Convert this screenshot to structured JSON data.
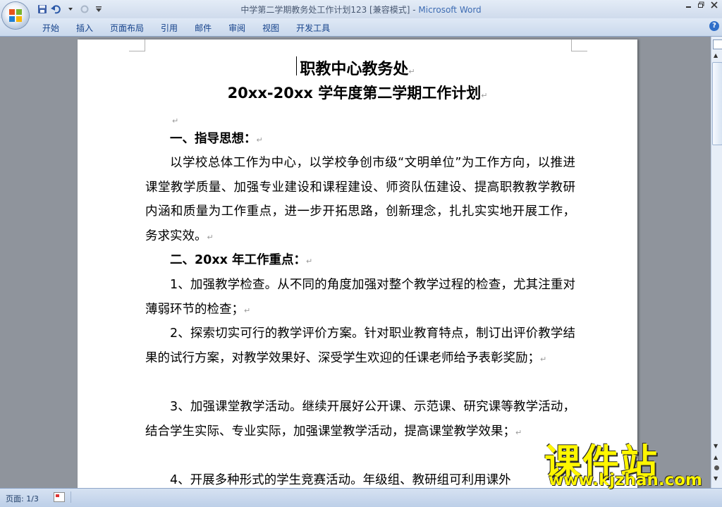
{
  "window": {
    "title_doc": "中学第二学期教务处工作计划123 [兼容模式]",
    "title_sep": " - ",
    "title_app": "Microsoft Word"
  },
  "ribbon": {
    "tabs": [
      "开始",
      "插入",
      "页面布局",
      "引用",
      "邮件",
      "审阅",
      "视图",
      "开发工具"
    ]
  },
  "document": {
    "title_line1": "职教中心教务处",
    "title_line2": "20xx-20xx 学年度第二学期工作计划",
    "paragraphs": [
      {
        "text": "一、指导思想：",
        "bold": true
      },
      {
        "text": "以学校总体工作为中心，以学校争创市级“文明单位”为工作方向，以推进课堂教学质量、加强专业建设和课程建设、师资队伍建设、提高职教教学教研内涵和质量为工作重点，进一步开拓思路，创新理念，扎扎实实地开展工作，务求实效。",
        "bold": false
      },
      {
        "text": "二、20xx 年工作重点：",
        "bold": true
      },
      {
        "text": "1、加强教学检查。从不同的角度加强对整个教学过程的检查，尤其注重对薄弱环节的检查；",
        "bold": false
      },
      {
        "text": "2、探索切实可行的教学评价方案。针对职业教育特点，制订出评价教学结果的试行方案，对教学效果好、深受学生欢迎的任课老师给予表彰奖励；",
        "bold": false
      },
      {
        "text": "3、加强课堂教学活动。继续开展好公开课、示范课、研究课等教学活动，结合学生实际、专业实际，加强课堂教学活动，提高课堂教学效果；",
        "bold": false
      },
      {
        "text": "4、开展多种形式的学生竞赛活动。年级组、教研组可利用课外",
        "bold": false
      }
    ]
  },
  "status": {
    "page_count": "页面: 1/3"
  },
  "watermark": {
    "title": "课件站",
    "url": "www.kjzhan.com"
  },
  "colors": {
    "ribbon_text": "#15428b",
    "app_title": "#3d6cb3",
    "workspace": "#8f949c",
    "watermark": "#fff600"
  }
}
